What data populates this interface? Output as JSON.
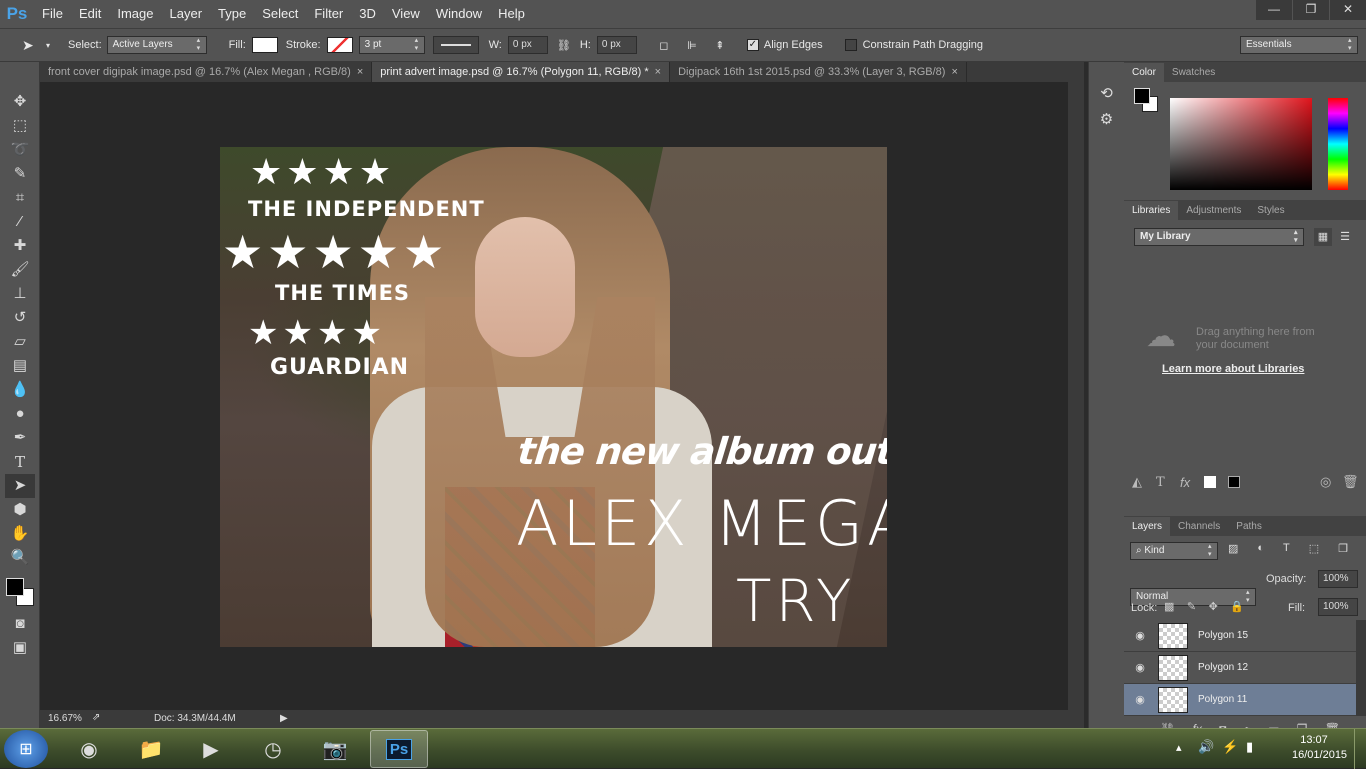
{
  "app": {
    "logo": "Ps"
  },
  "menu": [
    "File",
    "Edit",
    "Image",
    "Layer",
    "Type",
    "Select",
    "Filter",
    "3D",
    "View",
    "Window",
    "Help"
  ],
  "window_controls": {
    "minimize": "—",
    "restore": "❐",
    "close": "✕"
  },
  "options_bar": {
    "select_label": "Select:",
    "select_value": "Active Layers",
    "fill_label": "Fill:",
    "stroke_label": "Stroke:",
    "stroke_width": "3 pt",
    "w_label": "W:",
    "w_value": "0 px",
    "h_label": "H:",
    "h_value": "0 px",
    "align_edges": "Align Edges",
    "align_edges_checked": true,
    "constrain": "Constrain Path Dragging",
    "workspace": "Essentials"
  },
  "tabs": [
    {
      "label": "front cover digipak image.psd @ 16.7% (Alex Megan , RGB/8)",
      "close": "×"
    },
    {
      "label": "print advert image.psd @ 16.7% (Polygon 11, RGB/8) *",
      "close": "×"
    },
    {
      "label": "Digipack 16th 1st 2015.psd @ 33.3% (Layer 3, RGB/8)",
      "close": "×"
    }
  ],
  "canvas": {
    "stars1": "★★★★",
    "review1": "THE INDEPENDENT",
    "stars2": "★★★★★",
    "review2": "THE TIMES",
    "stars3": "★★★★",
    "review3": "GUARDIAN",
    "headline": "the new album out now",
    "artist": "ALEX MEGAN",
    "title": "TRY"
  },
  "status": {
    "zoom": "16.67%",
    "doc": "Doc: 34.3M/44.4M",
    "arrow": "▶"
  },
  "color_panel": {
    "tabs": [
      "Color",
      "Swatches"
    ]
  },
  "libraries_panel": {
    "tabs": [
      "Libraries",
      "Adjustments",
      "Styles"
    ],
    "library": "My Library",
    "hint": "Drag anything here from your document",
    "link": "Learn more about Libraries"
  },
  "layers_panel": {
    "tabs": [
      "Layers",
      "Channels",
      "Paths"
    ],
    "kind": "Kind",
    "blend": "Normal",
    "opacity_label": "Opacity:",
    "opacity": "100%",
    "lock_label": "Lock:",
    "fill_label": "Fill:",
    "fill": "100%",
    "layers": [
      "Polygon 15",
      "Polygon 12",
      "Polygon 11"
    ]
  },
  "taskbar": {
    "time": "13:07",
    "date": "16/01/2015"
  }
}
